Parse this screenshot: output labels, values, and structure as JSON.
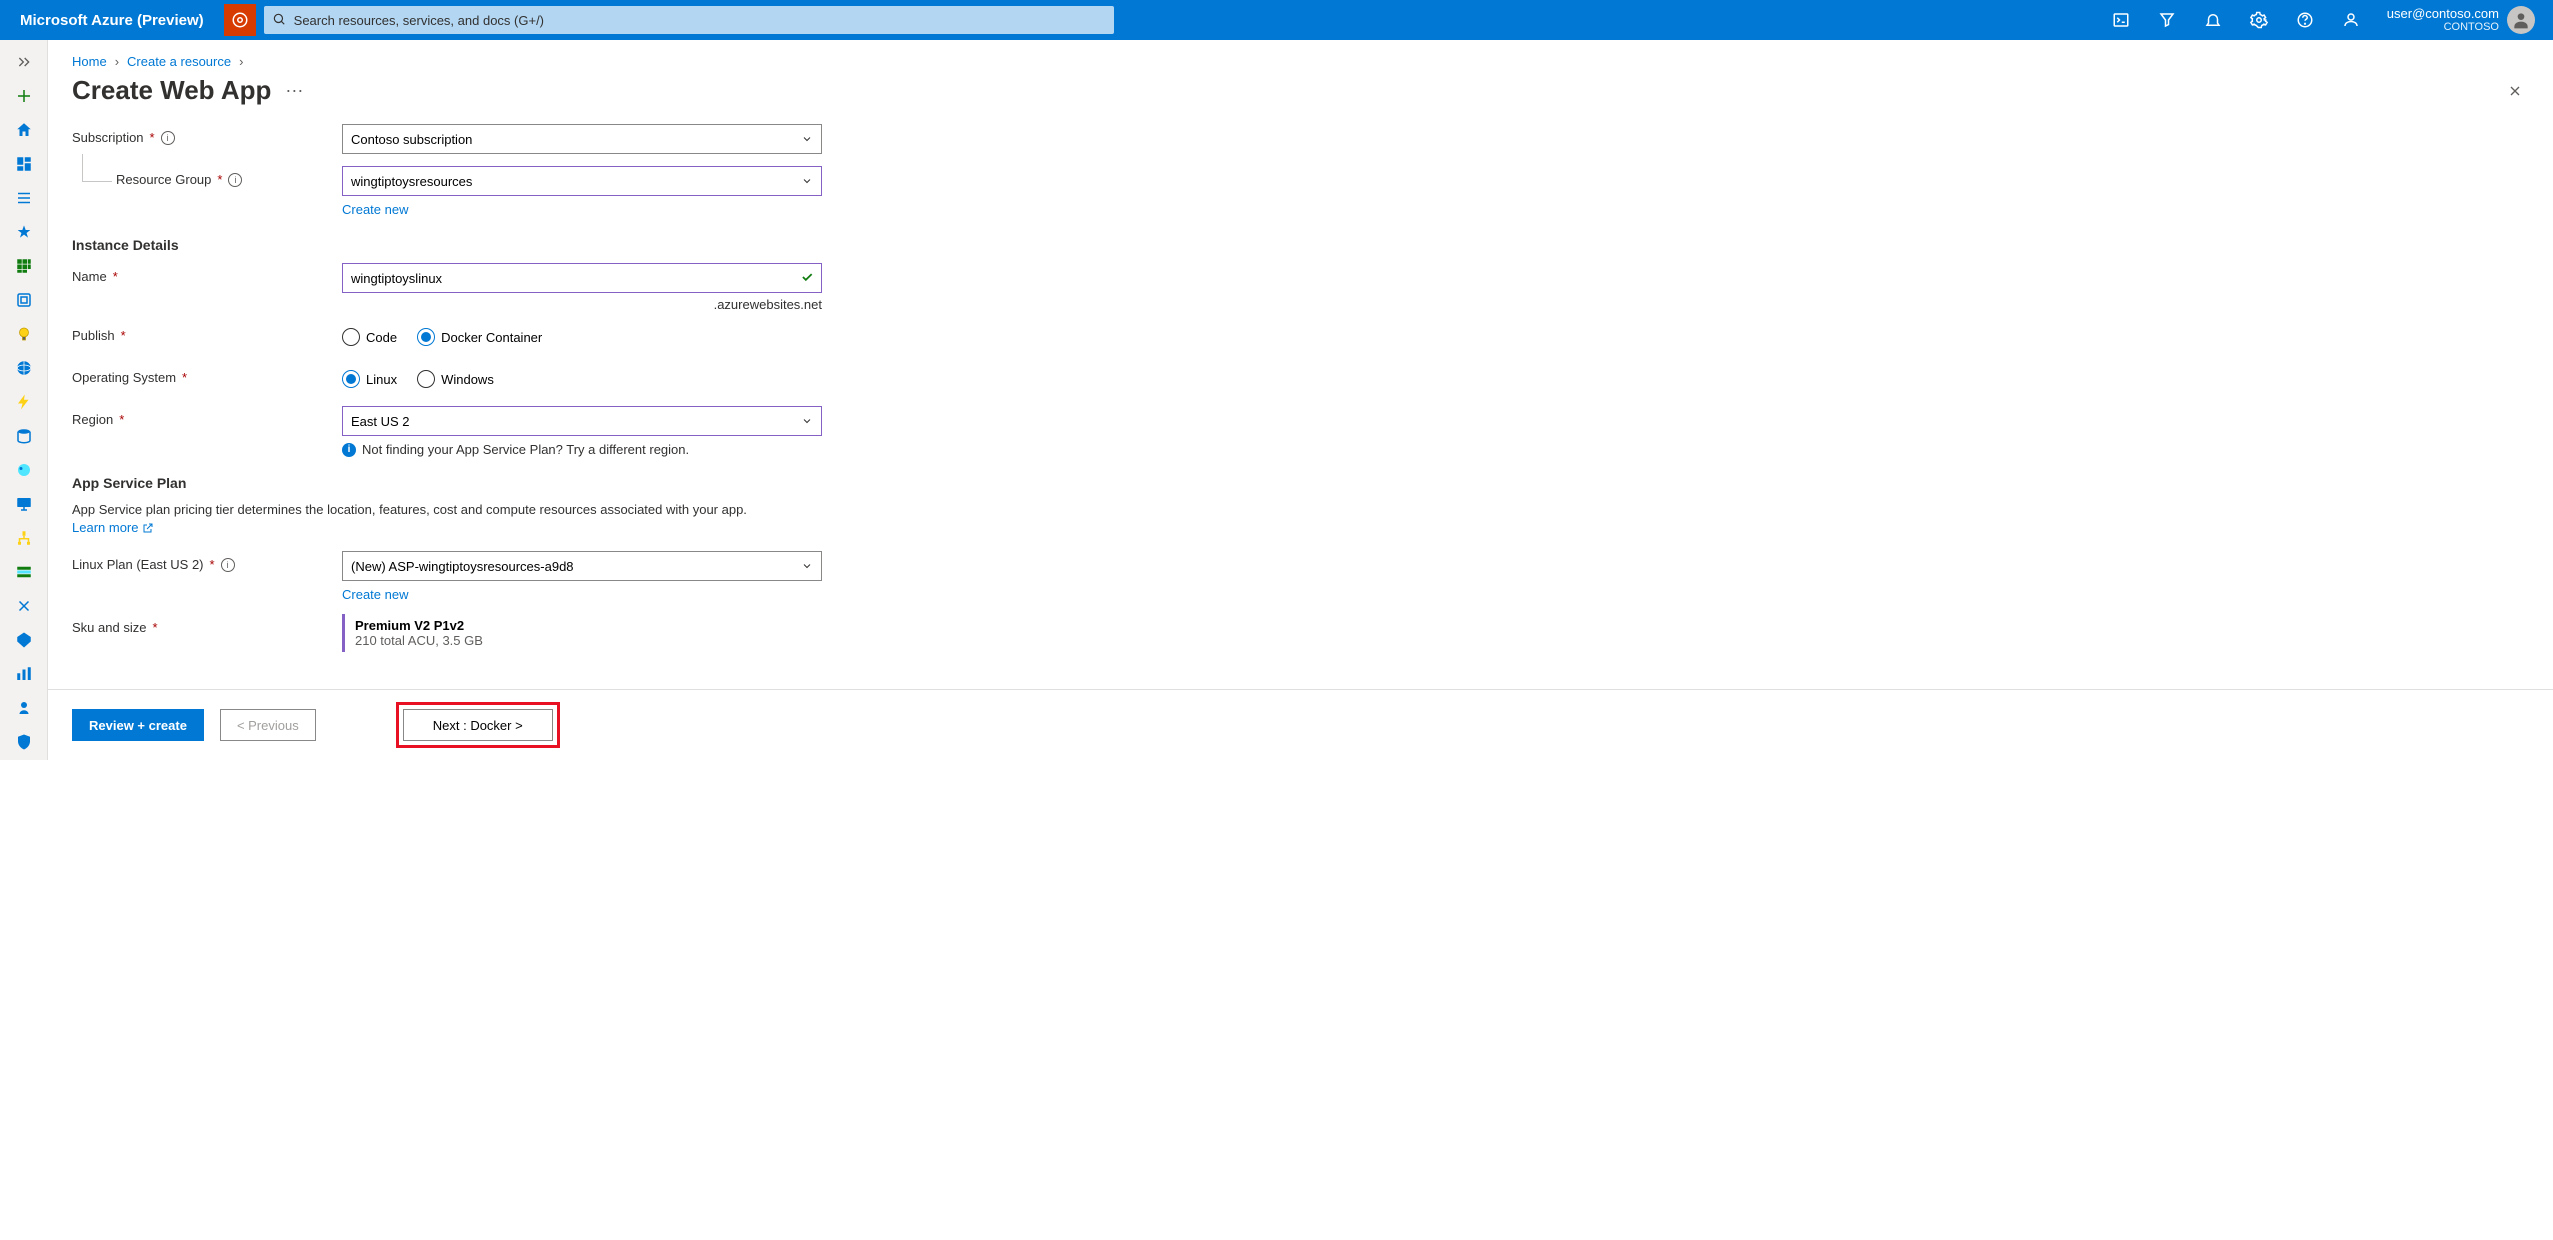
{
  "brand": "Microsoft Azure (Preview)",
  "search_placeholder": "Search resources, services, and docs (G+/)",
  "account": {
    "email": "user@contoso.com",
    "tenant": "CONTOSO"
  },
  "breadcrumbs": {
    "home": "Home",
    "create_resource": "Create a resource"
  },
  "page_title": "Create Web App",
  "form": {
    "subscription": {
      "label": "Subscription",
      "value": "Contoso subscription"
    },
    "resource_group": {
      "label": "Resource Group",
      "value": "wingtiptoysresources",
      "create_new": "Create new"
    },
    "instance_details_title": "Instance Details",
    "name": {
      "label": "Name",
      "value": "wingtiptoyslinux",
      "suffix": ".azurewebsites.net"
    },
    "publish": {
      "label": "Publish",
      "code": "Code",
      "docker": "Docker Container"
    },
    "os": {
      "label": "Operating System",
      "linux": "Linux",
      "windows": "Windows"
    },
    "region": {
      "label": "Region",
      "value": "East US 2",
      "hint": "Not finding your App Service Plan? Try a different region."
    },
    "plan_title": "App Service Plan",
    "plan_desc": "App Service plan pricing tier determines the location, features, cost and compute resources associated with your app.",
    "learn_more": "Learn more",
    "linux_plan": {
      "label": "Linux Plan (East US 2)",
      "value": "(New) ASP-wingtiptoysresources-a9d8",
      "create_new": "Create new"
    },
    "sku": {
      "label": "Sku and size",
      "title": "Premium V2 P1v2",
      "sub": "210 total ACU, 3.5 GB"
    }
  },
  "footer": {
    "review": "Review + create",
    "prev": "< Previous",
    "next": "Next : Docker >"
  }
}
